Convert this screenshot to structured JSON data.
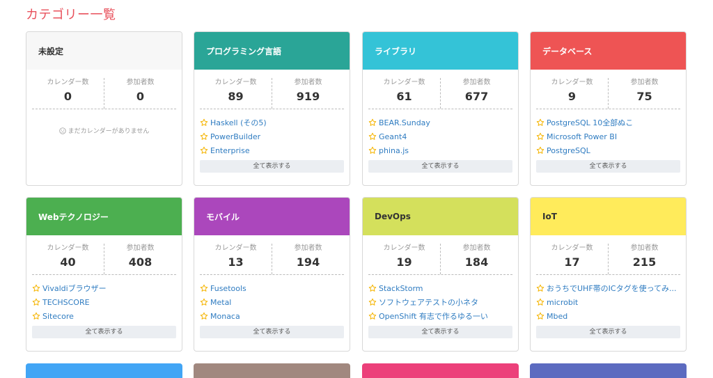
{
  "page": {
    "title": "カテゴリー一覧"
  },
  "labels": {
    "calendars": "カレンダー数",
    "participants": "参加者数",
    "show_all": "全て表示する",
    "empty": "まだカレンダーがありません"
  },
  "cards": [
    {
      "name": "未設定",
      "color": "#f7f7f7",
      "calendars": "0",
      "participants": "0",
      "items": []
    },
    {
      "name": "プログラミング言語",
      "color": "#2aa597",
      "calendars": "89",
      "participants": "919",
      "items": [
        "Haskell (その5)",
        "PowerBuilder",
        "Enterprise"
      ]
    },
    {
      "name": "ライブラリ",
      "color": "#34c3d7",
      "calendars": "61",
      "participants": "677",
      "items": [
        "BEAR.Sunday",
        "Geant4",
        "phina.js"
      ]
    },
    {
      "name": "データベース",
      "color": "#ee5454",
      "calendars": "9",
      "participants": "75",
      "items": [
        "PostgreSQL 10全部ぬこ",
        "Microsoft Power BI",
        "PostgreSQL"
      ]
    },
    {
      "name": "Webテクノロジー",
      "color": "#4caf50",
      "calendars": "40",
      "participants": "408",
      "items": [
        "Vivaldiブラウザー",
        "TECHSCORE",
        "Sitecore"
      ]
    },
    {
      "name": "モバイル",
      "color": "#ab47bc",
      "calendars": "13",
      "participants": "194",
      "items": [
        "Fusetools",
        "Metal",
        "Monaca"
      ]
    },
    {
      "name": "DevOps",
      "color": "#d4e05c",
      "calendars": "19",
      "participants": "184",
      "items": [
        "StackStorm",
        "ソフトウェアテストの小ネタ",
        "OpenShift 有志で作るゆる一い"
      ]
    },
    {
      "name": "IoT",
      "color": "#ffeb5b",
      "calendars": "17",
      "participants": "215",
      "items": [
        "おうちでUHF帯のICタグを使ってみ...",
        "microbit",
        "Mbed"
      ]
    }
  ],
  "partial_cards": [
    {
      "color": "#42a5f5"
    },
    {
      "color": "#a1887f"
    },
    {
      "color": "#ec407a"
    },
    {
      "color": "#5c6bc0"
    }
  ],
  "icons": {
    "star": "star-icon",
    "empty": "sad-face-icon"
  },
  "colors": {
    "title": "#e8505b",
    "link": "#2f7cc1",
    "star": "#f5b400"
  }
}
